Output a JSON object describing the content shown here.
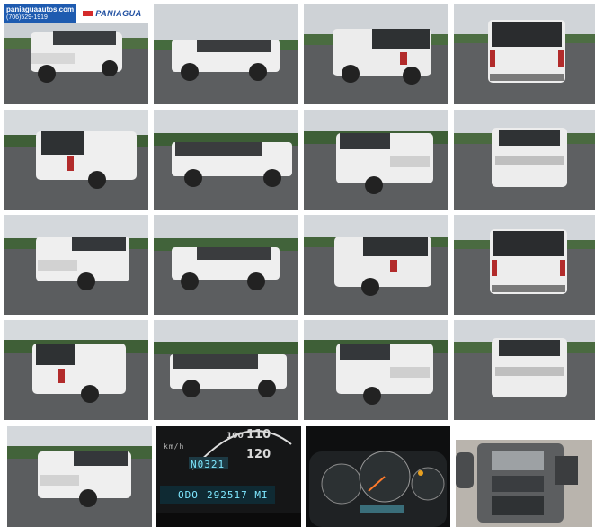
{
  "dealer": {
    "website": "paniaguaautos.com",
    "phone": "(706)529-1919",
    "brand": "PANIAGUA"
  },
  "dashboard": {
    "odometer_label": "ODO",
    "odometer_value": "292517 MI",
    "trip_display": "N0321",
    "speed_marks": [
      "100",
      "110",
      "120"
    ],
    "unit": "km/h"
  },
  "photos": [
    {
      "view": "front-left"
    },
    {
      "view": "left-side"
    },
    {
      "view": "rear-left"
    },
    {
      "view": "rear"
    },
    {
      "view": "rear-left"
    },
    {
      "view": "right-side"
    },
    {
      "view": "front-left"
    },
    {
      "view": "front"
    },
    {
      "view": "front-left"
    },
    {
      "view": "left-side"
    },
    {
      "view": "rear-left"
    },
    {
      "view": "rear"
    },
    {
      "view": "rear-left"
    },
    {
      "view": "right-side"
    },
    {
      "view": "front-left"
    },
    {
      "view": "front"
    },
    {
      "view": "front-left"
    },
    {
      "view": "odometer"
    },
    {
      "view": "instrument-cluster"
    },
    {
      "view": "radio-console"
    }
  ]
}
